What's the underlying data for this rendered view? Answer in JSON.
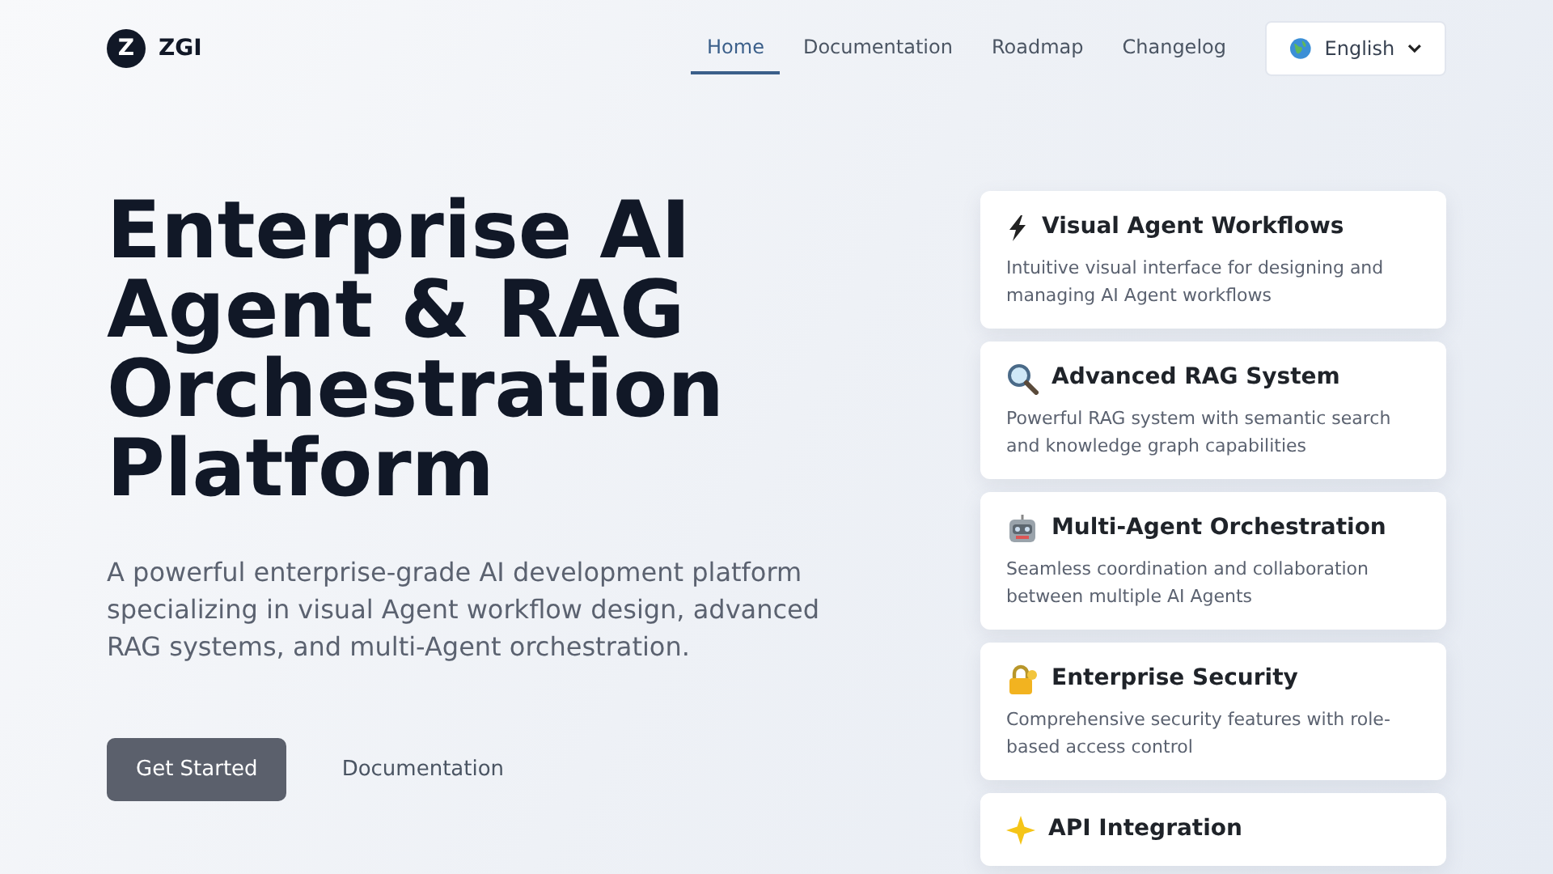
{
  "brand": {
    "name": "ZGI",
    "logo_letter": "Z"
  },
  "nav": [
    {
      "label": "Home",
      "selected": true
    },
    {
      "label": "Documentation",
      "selected": false
    },
    {
      "label": "Roadmap",
      "selected": false
    },
    {
      "label": "Changelog",
      "selected": false
    }
  ],
  "language_select": {
    "value": "English"
  },
  "hero": {
    "title": "Enterprise AI Agent & RAG Orchestration Platform",
    "subtitle": "A powerful enterprise-grade AI development platform specializing in visual Agent workflow design, advanced RAG systems, and multi-Agent orchestration.",
    "buttons": [
      {
        "label": "Get Started",
        "kind": "primary"
      },
      {
        "label": "Documentation",
        "kind": "link"
      }
    ]
  },
  "features": [
    {
      "kind": "lightning",
      "title": "Visual Agent Workflows",
      "description": "Intuitive visual interface for designing and managing AI Agent workflows"
    },
    {
      "kind": "magnifier",
      "title": "Advanced RAG System",
      "description": "Powerful RAG system with semantic search and knowledge graph capabilities"
    },
    {
      "kind": "robot",
      "title": "Multi-Agent Orchestration",
      "description": "Seamless coordination and collaboration between multiple AI Agents"
    },
    {
      "kind": "lock",
      "title": "Enterprise Security",
      "description": "Comprehensive security features with role-based access control"
    },
    {
      "kind": "sparkle",
      "title": "API Integration"
    }
  ]
}
